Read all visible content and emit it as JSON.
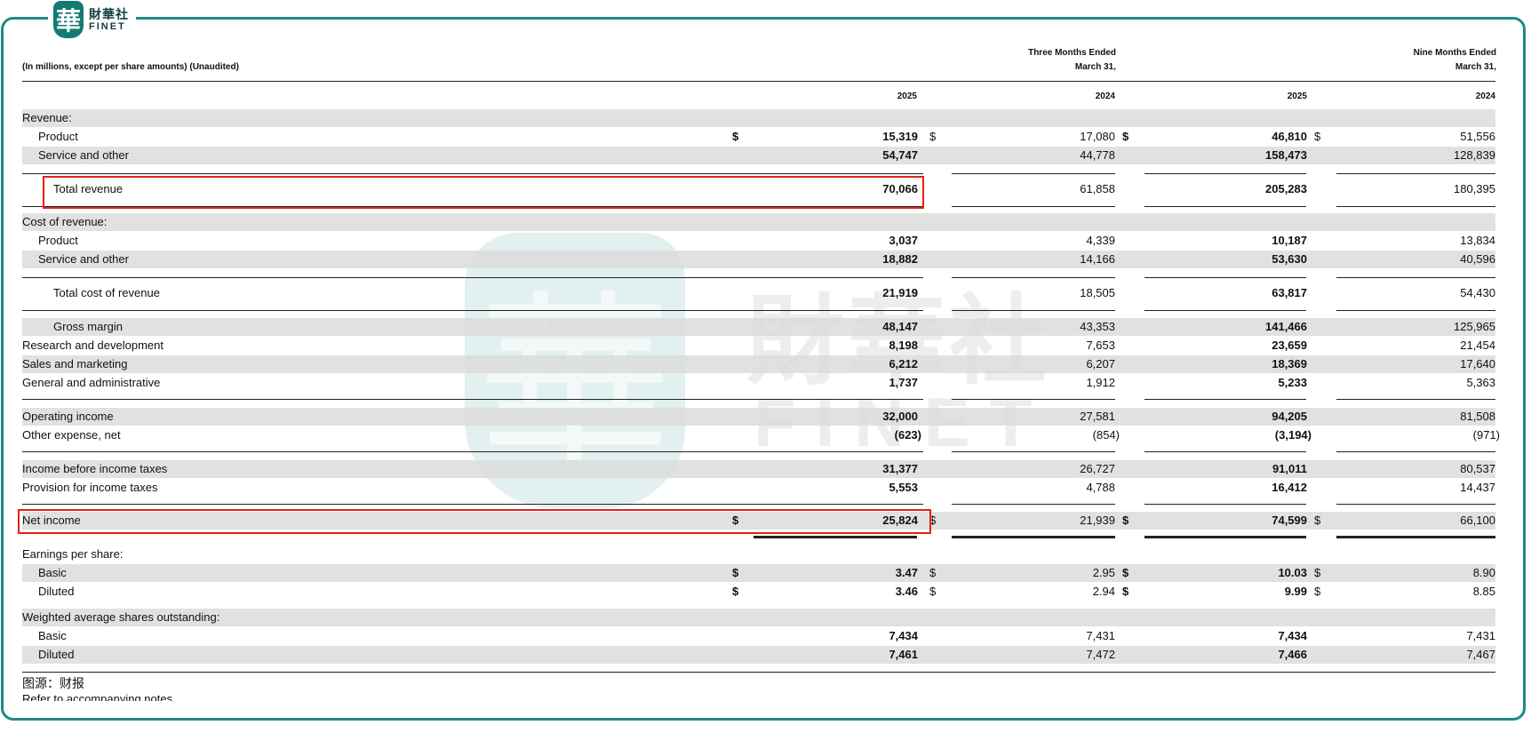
{
  "logo": {
    "seal_char": "華",
    "cn": "財華社",
    "en": "FINET"
  },
  "watermark": {
    "seal_char": "華",
    "cn": "財華社",
    "en": "FINET"
  },
  "header": {
    "units": "(In millions, except per share amounts) (Unaudited)",
    "three_months_line1": "Three Months Ended",
    "three_months_line2": "March 31,",
    "nine_months_line1": "Nine Months Ended",
    "nine_months_line2": "March 31,",
    "years": [
      "2025",
      "2024",
      "2025",
      "2024"
    ]
  },
  "rows": [
    {
      "label": "Revenue:",
      "values": [
        "",
        "",
        "",
        ""
      ]
    },
    {
      "label": "Product",
      "dollar": true,
      "values": [
        "15,319",
        "17,080",
        "46,810",
        "51,556"
      ]
    },
    {
      "label": "Service and other",
      "values": [
        "54,747",
        "44,778",
        "158,473",
        "128,839"
      ]
    },
    {
      "label": "Total revenue",
      "values": [
        "70,066",
        "61,858",
        "205,283",
        "180,395"
      ]
    },
    {
      "label": "Cost of revenue:",
      "values": [
        "",
        "",
        "",
        ""
      ]
    },
    {
      "label": "Product",
      "values": [
        "3,037",
        "4,339",
        "10,187",
        "13,834"
      ]
    },
    {
      "label": "Service and other",
      "values": [
        "18,882",
        "14,166",
        "53,630",
        "40,596"
      ]
    },
    {
      "label": "Total cost of revenue",
      "values": [
        "21,919",
        "18,505",
        "63,817",
        "54,430"
      ]
    },
    {
      "label": "Gross margin",
      "values": [
        "48,147",
        "43,353",
        "141,466",
        "125,965"
      ]
    },
    {
      "label": "Research and development",
      "values": [
        "8,198",
        "7,653",
        "23,659",
        "21,454"
      ]
    },
    {
      "label": "Sales and marketing",
      "values": [
        "6,212",
        "6,207",
        "18,369",
        "17,640"
      ]
    },
    {
      "label": "General and administrative",
      "values": [
        "1,737",
        "1,912",
        "5,233",
        "5,363"
      ]
    },
    {
      "label": "Operating income",
      "values": [
        "32,000",
        "27,581",
        "94,205",
        "81,508"
      ]
    },
    {
      "label": "Other expense, net",
      "values": [
        "(623)",
        "(854)",
        "(3,194)",
        "(971)"
      ]
    },
    {
      "label": "Income before income taxes",
      "values": [
        "31,377",
        "26,727",
        "91,011",
        "80,537"
      ]
    },
    {
      "label": "Provision for income taxes",
      "values": [
        "5,553",
        "4,788",
        "16,412",
        "14,437"
      ]
    },
    {
      "label": "Net income",
      "dollar": true,
      "values": [
        "25,824",
        "21,939",
        "74,599",
        "66,100"
      ]
    },
    {
      "label": "Earnings per share:",
      "values": [
        "",
        "",
        "",
        ""
      ]
    },
    {
      "label": "Basic",
      "dollar": true,
      "values": [
        "3.47",
        "2.95",
        "10.03",
        "8.90"
      ]
    },
    {
      "label": "Diluted",
      "dollar": true,
      "values": [
        "3.46",
        "2.94",
        "9.99",
        "8.85"
      ]
    },
    {
      "label": "Weighted average shares outstanding:",
      "values": [
        "",
        "",
        "",
        ""
      ]
    },
    {
      "label": "Basic",
      "values": [
        "7,434",
        "7,431",
        "7,434",
        "7,431"
      ]
    },
    {
      "label": "Diluted",
      "values": [
        "7,461",
        "7,472",
        "7,466",
        "7,467"
      ]
    }
  ],
  "dollar_sign": "$",
  "source_note": "图源：财报",
  "clipped_note": "Refer to accompanying notes",
  "colors": {
    "frame": "#1f8a86",
    "highlight": "#e32119",
    "shade": "#dadada"
  }
}
